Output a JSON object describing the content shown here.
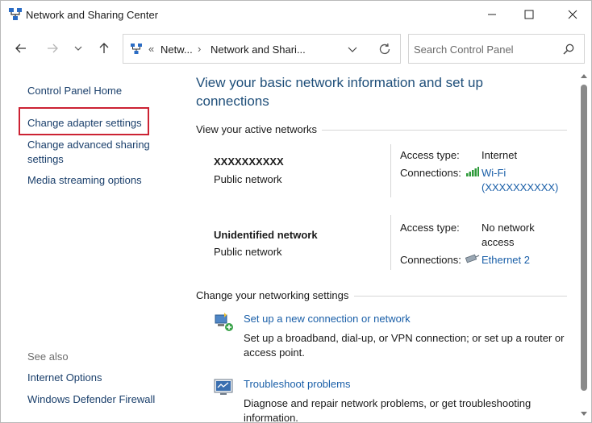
{
  "window": {
    "title": "Network and Sharing Center"
  },
  "address": {
    "chevrons": "«",
    "crumb1": "Netw...",
    "crumb2": "Network and Shari...",
    "sep": "›"
  },
  "search": {
    "placeholder": "Search Control Panel"
  },
  "left_pane": {
    "control_panel_home": "Control Panel Home",
    "change_adapter": "Change adapter settings",
    "change_advanced": "Change advanced sharing settings",
    "media_streaming": "Media streaming options",
    "see_also": "See also",
    "internet_options": "Internet Options",
    "firewall": "Windows Defender Firewall"
  },
  "main": {
    "title": "View your basic network information and set up connections",
    "active_networks_header": "View your active networks",
    "networks": [
      {
        "name": "XXXXXXXXXX",
        "type": "Public network",
        "access_label": "Access type:",
        "access_value": "Internet",
        "connections_label": "Connections:",
        "connection_link": "Wi-Fi (XXXXXXXXXX)"
      },
      {
        "name": "Unidentified network",
        "type": "Public network",
        "access_label": "Access type:",
        "access_value": "No network access",
        "connections_label": "Connections:",
        "connection_link": "Ethernet 2"
      }
    ],
    "change_settings_header": "Change your networking settings",
    "tasks": [
      {
        "icon": "new-connection-icon",
        "link": "Set up a new connection or network",
        "desc": "Set up a broadband, dial-up, or VPN connection; or set up a router or access point."
      },
      {
        "icon": "troubleshoot-icon",
        "link": "Troubleshoot problems",
        "desc": "Diagnose and repair network problems, or get troubleshooting information."
      }
    ]
  },
  "colors": {
    "link": "#1a5fa8",
    "heading": "#1e4e79",
    "highlight": "#cc2233"
  }
}
